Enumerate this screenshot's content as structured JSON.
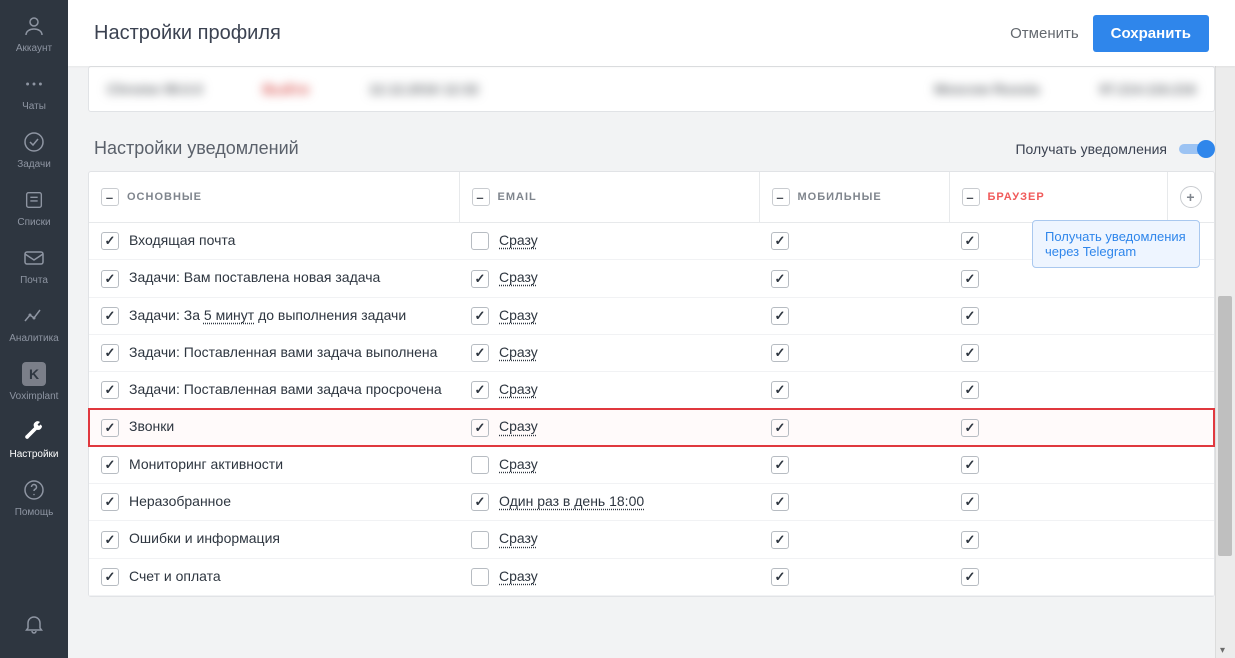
{
  "header": {
    "title": "Настройки профиля",
    "cancel": "Отменить",
    "save": "Сохранить"
  },
  "sidebar": [
    {
      "key": "account",
      "label": "Аккаунт"
    },
    {
      "key": "chats",
      "label": "Чаты"
    },
    {
      "key": "tasks",
      "label": "Задачи"
    },
    {
      "key": "lists",
      "label": "Списки"
    },
    {
      "key": "mail",
      "label": "Почта"
    },
    {
      "key": "analytics",
      "label": "Аналитика"
    },
    {
      "key": "voximplant",
      "label": "Voximplant"
    },
    {
      "key": "settings",
      "label": "Настройки"
    },
    {
      "key": "help",
      "label": "Помощь"
    }
  ],
  "blurred_row": {
    "c1": "Chrome 99.0.0",
    "c2": "Выйти",
    "c3": "12.12.2016 12:32",
    "c4": "Moscow Russia",
    "c5": "97.214.116.216"
  },
  "section": {
    "title": "Настройки уведомлений",
    "toggle_label": "Получать уведомления"
  },
  "columns": {
    "main": "ОСНОВНЫЕ",
    "email": "EMAIL",
    "mobile": "МОБИЛЬНЫЕ",
    "browser": "БРАУЗЕР"
  },
  "tooltip": "Получать уведомления через Telegram",
  "timing_link_minutes": "5 минут",
  "rows": [
    {
      "label_pre": "Входящая почта",
      "label_link": "",
      "label_post": "",
      "main": true,
      "email_chk": false,
      "email_link": "Сразу",
      "mobile": true,
      "browser": true,
      "highlight": false
    },
    {
      "label_pre": "Задачи: Вам поставлена новая задача",
      "label_link": "",
      "label_post": "",
      "main": true,
      "email_chk": true,
      "email_link": "Сразу",
      "mobile": true,
      "browser": true,
      "highlight": false
    },
    {
      "label_pre": "Задачи: За ",
      "label_link": "5 минут",
      "label_post": " до выполнения задачи",
      "main": true,
      "email_chk": true,
      "email_link": "Сразу",
      "mobile": true,
      "browser": true,
      "highlight": false
    },
    {
      "label_pre": "Задачи: Поставленная вами задача выполнена",
      "label_link": "",
      "label_post": "",
      "main": true,
      "email_chk": true,
      "email_link": "Сразу",
      "mobile": true,
      "browser": true,
      "highlight": false
    },
    {
      "label_pre": "Задачи: Поставленная вами задача просрочена",
      "label_link": "",
      "label_post": "",
      "main": true,
      "email_chk": true,
      "email_link": "Сразу",
      "mobile": true,
      "browser": true,
      "highlight": false
    },
    {
      "label_pre": "Звонки",
      "label_link": "",
      "label_post": "",
      "main": true,
      "email_chk": true,
      "email_link": "Сразу",
      "mobile": true,
      "browser": true,
      "highlight": true
    },
    {
      "label_pre": "Мониторинг активности",
      "label_link": "",
      "label_post": "",
      "main": true,
      "email_chk": false,
      "email_link": "Сразу",
      "mobile": true,
      "browser": true,
      "highlight": false
    },
    {
      "label_pre": "Неразобранное",
      "label_link": "",
      "label_post": "",
      "main": true,
      "email_chk": true,
      "email_link": "Один раз в день 18:00",
      "mobile": true,
      "browser": true,
      "highlight": false
    },
    {
      "label_pre": "Ошибки и информация",
      "label_link": "",
      "label_post": "",
      "main": true,
      "email_chk": false,
      "email_link": "Сразу",
      "mobile": true,
      "browser": true,
      "highlight": false
    },
    {
      "label_pre": "Счет и оплата",
      "label_link": "",
      "label_post": "",
      "main": true,
      "email_chk": false,
      "email_link": "Сразу",
      "mobile": true,
      "browser": true,
      "highlight": false
    }
  ]
}
